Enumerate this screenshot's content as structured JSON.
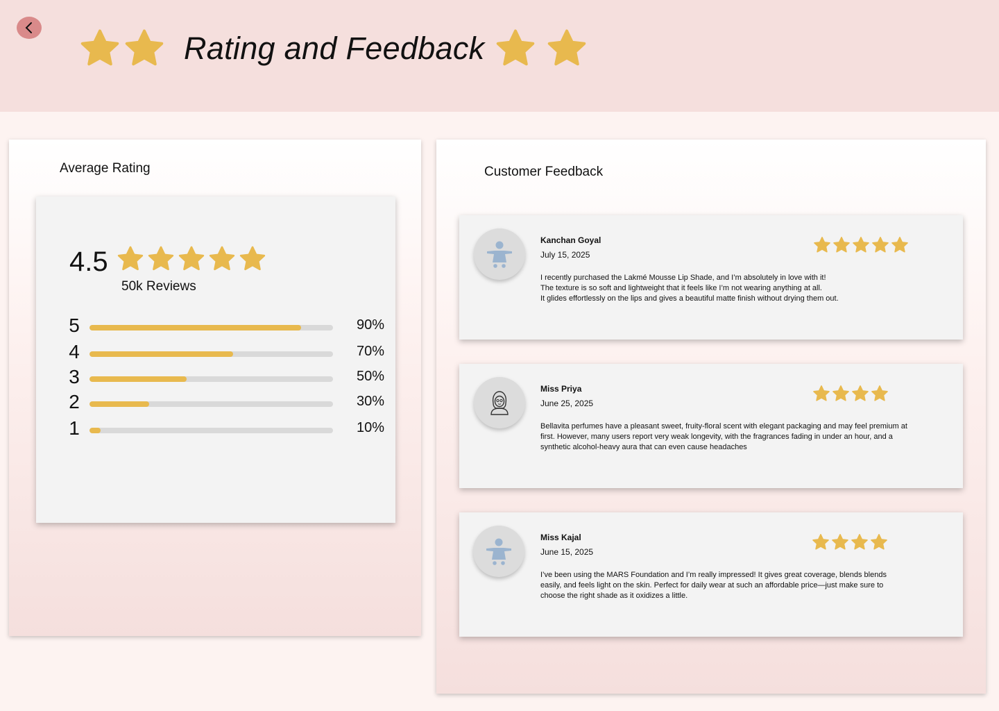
{
  "header": {
    "title": "Rating and Feedback",
    "back_icon": "chevron-left-icon",
    "star_color": "#e8b94e",
    "background": "#f5dfdd"
  },
  "average_panel": {
    "title": "Average Rating",
    "average": "4.5",
    "reviews": "50k Reviews",
    "star_count": 5,
    "breakdown": [
      {
        "stars": "5",
        "percent": "90%",
        "fill": 0.87
      },
      {
        "stars": "4",
        "percent": "70%",
        "fill": 0.59
      },
      {
        "stars": "3",
        "percent": "50%",
        "fill": 0.4
      },
      {
        "stars": "2",
        "percent": "30%",
        "fill": 0.245
      },
      {
        "stars": "1",
        "percent": "10%",
        "fill": 0.045
      }
    ]
  },
  "feedback_panel": {
    "title": "Customer Feedback",
    "items": [
      {
        "name": "Kanchan Goyal",
        "date": "July 15, 2025",
        "stars": 5,
        "avatar": "child-avatar-icon",
        "text": "I recently purchased the Lakmé Mousse Lip Shade, and I’m absolutely in love with it!\nThe texture is so soft and lightweight that it feels like I’m not wearing anything at all.\nIt glides effortlessly on the lips and gives a beautiful matte finish without drying them out."
      },
      {
        "name": "Miss Priya",
        "date": "June 25, 2025",
        "stars": 4,
        "avatar": "woman-avatar-icon",
        "text": "Bellavita perfumes have a pleasant sweet, fruity-floral scent with elegant packaging and may feel premium at first. However, many users report very weak longevity, with the fragrances fading in under an hour, and a synthetic alcohol-heavy aura that can even cause headaches"
      },
      {
        "name": "Miss Kajal",
        "date": "June 15, 2025",
        "stars": 4,
        "avatar": "child-avatar-icon",
        "text": "I’ve been using the MARS Foundation and I’m really impressed! It gives great coverage, blends blends easily, and feels light on the skin. Perfect for daily wear at such an affordable price—just make sure to choose the right shade as it oxidizes a little."
      }
    ]
  }
}
